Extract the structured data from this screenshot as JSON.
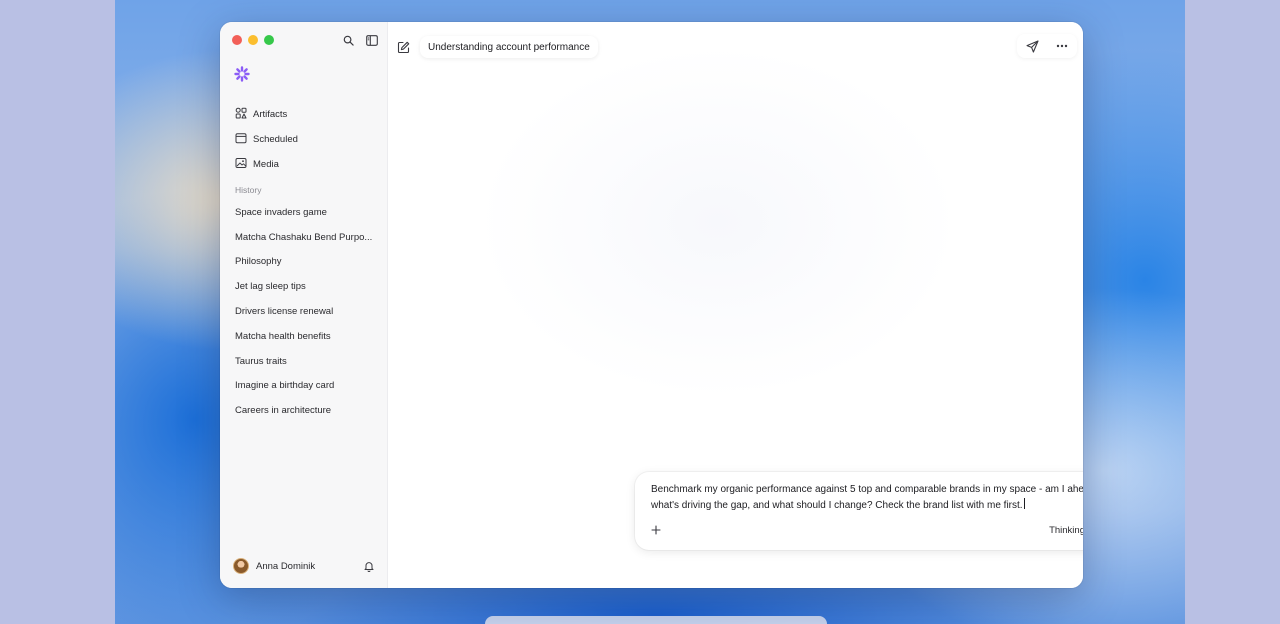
{
  "window": {
    "chat_title": "Understanding account performance"
  },
  "sidebar": {
    "nav": [
      {
        "label": "Artifacts",
        "icon": "artifacts-icon"
      },
      {
        "label": "Scheduled",
        "icon": "calendar-icon"
      },
      {
        "label": "Media",
        "icon": "image-icon"
      }
    ],
    "history_title": "History",
    "history": [
      "Space invaders game",
      "Matcha Chashaku Bend Purpo...",
      "Philosophy",
      "Jet lag sleep tips",
      "Drivers license renewal",
      "Matcha health benefits",
      "Taurus traits",
      "Imagine a birthday card",
      "Careers in architecture"
    ],
    "user": {
      "name": "Anna Dominik"
    }
  },
  "composer": {
    "prompt_text": "Benchmark my organic performance against 5 top and comparable brands in my space - am I ahead or behind, what's driving the gap, and what should I change? Check the brand list with me first.",
    "mode_label": "Thinking"
  },
  "colors": {
    "accent_logo": "#8b5cf6",
    "send_button": "#a9c8f5"
  }
}
